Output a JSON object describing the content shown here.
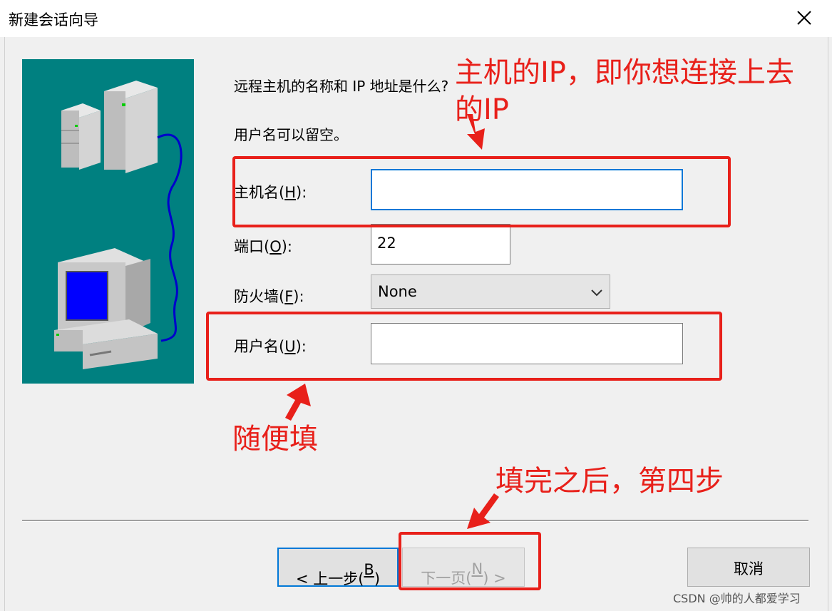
{
  "window": {
    "title": "新建会话向导",
    "close_symbol": "✕"
  },
  "wizard": {
    "question": "远程主机的名称和 IP 地址是什么?",
    "hint": "用户名可以留空。",
    "hostname": {
      "label": "主机名",
      "accel": "H",
      "value": ""
    },
    "port": {
      "label": "端口",
      "accel": "O",
      "value": "22"
    },
    "firewall": {
      "label": "防火墙",
      "accel": "F",
      "selected": "None"
    },
    "username": {
      "label": "用户名",
      "accel": "U",
      "value": ""
    }
  },
  "buttons": {
    "back_prefix": "< 上一步(",
    "back_accel": "B",
    "back_suffix": ")",
    "next_prefix": "下一页(",
    "next_accel": "N",
    "next_suffix": ") >",
    "cancel": "取消"
  },
  "annotations": {
    "host_line1": "主机的IP，即你想连接上去",
    "host_line2": "的IP",
    "username_note": "随便填",
    "next_note": "填完之后，第四步"
  },
  "watermark": "CSDN @帅的人都爱学习",
  "colors": {
    "annotation": "#e8201a",
    "focus": "#0078d7",
    "teal": "#008080"
  }
}
